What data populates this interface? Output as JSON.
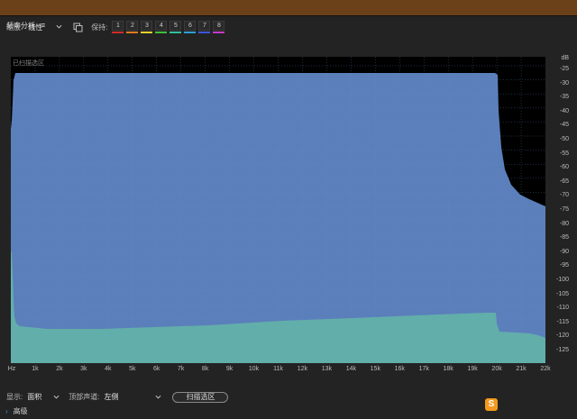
{
  "panel": {
    "title": "频率分析",
    "menu_icon": "hamburger-menu-icon"
  },
  "toolbar": {
    "scale_label": "缩放:",
    "scale_value": "线性",
    "copy_icon": "copy-icon",
    "hold_label": "保持:",
    "slots": [
      {
        "label": "1",
        "color": "#d42a2a"
      },
      {
        "label": "2",
        "color": "#e07b1c"
      },
      {
        "label": "3",
        "color": "#e6d22b"
      },
      {
        "label": "4",
        "color": "#3fbf3a"
      },
      {
        "label": "5",
        "color": "#2fc09c"
      },
      {
        "label": "6",
        "color": "#2aa0d8"
      },
      {
        "label": "7",
        "color": "#3b57d8"
      },
      {
        "label": "8",
        "color": "#c43ac9"
      }
    ]
  },
  "graph": {
    "overlay_label": "已扫描选区",
    "colors": {
      "background": "#000000",
      "upper": "#5b7fbb",
      "lower": "#62aeaa",
      "grid": "#6a8fc7"
    },
    "unit": "dB",
    "y_ticks": [
      "-25",
      "-30",
      "-35",
      "-40",
      "-45",
      "-50",
      "-55",
      "-60",
      "-65",
      "-70",
      "-75",
      "-80",
      "-85",
      "-90",
      "-95",
      "-100",
      "-105",
      "-110",
      "-115",
      "-120",
      "-125"
    ],
    "x_ticks": [
      "Hz",
      "1k",
      "2k",
      "3k",
      "4k",
      "5k",
      "6k",
      "7k",
      "8k",
      "9k",
      "10k",
      "11k",
      "12k",
      "13k",
      "14k",
      "15k",
      "16k",
      "17k",
      "18k",
      "19k",
      "20k",
      "21k",
      "22k"
    ]
  },
  "footer": {
    "display_label": "显示:",
    "display_value": "面积",
    "channel_label": "顶部声道:",
    "channel_value": "左侧",
    "scan_button": "扫描选区",
    "advanced": "高级"
  },
  "watermark": {
    "logo": "S",
    "text": ""
  }
}
